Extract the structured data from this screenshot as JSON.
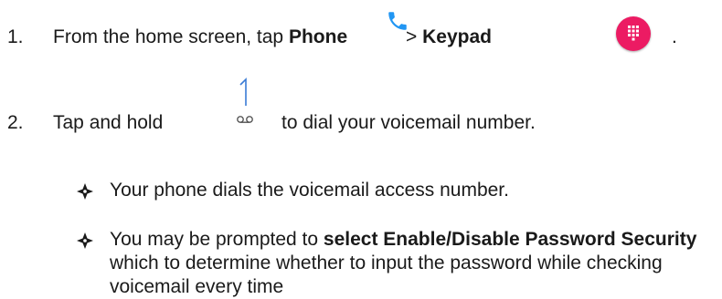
{
  "step1": {
    "number": "1.",
    "text_before": "From the home screen, tap",
    "phone_label": "Phone",
    "gt": ">",
    "keypad_label": "Keypad",
    "period": ".",
    "phone_icon": "phone-icon",
    "keypad_icon": "dialpad-icon",
    "keypad_color": "#ec1b63",
    "phone_color": "#2196f3"
  },
  "step2": {
    "number": "2.",
    "text_before": "Tap and hold",
    "key_digit": "1",
    "key_icon": "voicemail-icon",
    "text_after": "to dial your voicemail number."
  },
  "bullets": [
    {
      "text": "Your phone dials the voicemail access number."
    },
    {
      "bold1": "select Enable/Disable Password",
      "prefix": "You may be prompted to",
      "bold2": "Security",
      "suffix": "which to determine whether to input the password while checking voicemail every time"
    }
  ],
  "bullet_icon": "four-petal-diamond"
}
